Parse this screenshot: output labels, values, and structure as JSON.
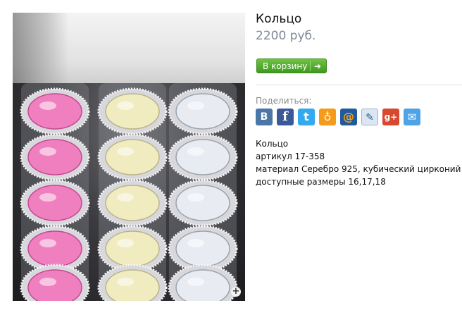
{
  "product": {
    "title": "Кольцо",
    "price": "2200 руб.",
    "cart_button_label": "В корзину"
  },
  "share": {
    "label": "Поделиться:",
    "services": [
      "vk-icon",
      "facebook-icon",
      "twitter-icon",
      "odnoklassniki-icon",
      "mailru-icon",
      "livejournal-icon",
      "googleplus-icon",
      "email-icon"
    ]
  },
  "description": {
    "name": "Кольцо",
    "article": "артикул 17-358",
    "material": "материал Серебро 925, кубический цирконий",
    "sizes": "доступные размеры 16,17,18"
  },
  "colors": {
    "accent_green": "#4fa82a",
    "price_gray": "#7f8a99",
    "pink_stones": "#f07fc0",
    "yellow_stones": "#f0ecc0",
    "white_stones": "#e8ecf2"
  }
}
